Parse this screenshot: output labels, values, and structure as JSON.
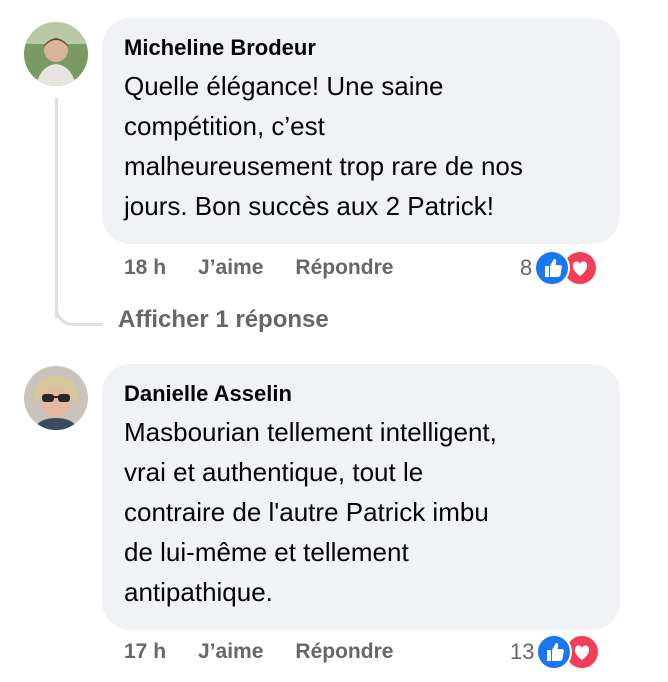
{
  "comments": [
    {
      "author": "Micheline Brodeur",
      "text_lines": [
        "Quelle élégance! Une saine",
        "compétition, c’est",
        "malheureusement trop rare de nos",
        "jours. Bon succès aux 2 Patrick!"
      ],
      "time": "18 h",
      "like_label": "J’aime",
      "reply_label": "Répondre",
      "reaction_count": "8",
      "reaction_icons": [
        "like-icon",
        "love-icon"
      ]
    },
    {
      "author": "Danielle Asselin",
      "text_lines": [
        "Masbourian tellement intelligent,",
        "vrai et authentique, tout le",
        "contraire de l'autre Patrick imbu",
        "de lui-même et tellement",
        "antipathique."
      ],
      "time": "17 h",
      "like_label": "J’aime",
      "reply_label": "Répondre",
      "reaction_count": "13",
      "reaction_icons": [
        "like-icon",
        "love-icon"
      ]
    }
  ],
  "view_replies_label": "Afficher 1 réponse",
  "colors": {
    "bubble": "#f0f2f5",
    "secondary_text": "#65676b",
    "like_blue": "#1877f2",
    "love_red": "#f33e58"
  }
}
